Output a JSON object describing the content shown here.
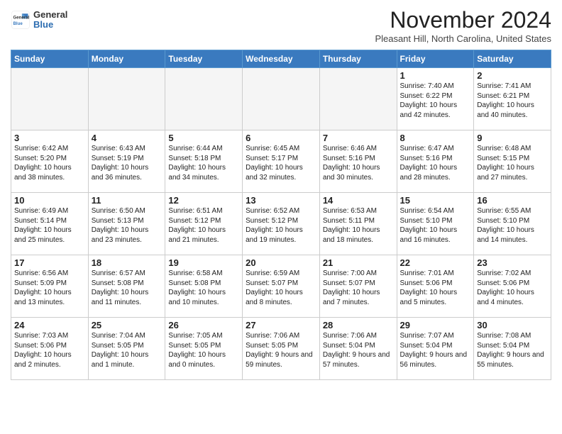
{
  "header": {
    "logo_line1": "General",
    "logo_line2": "Blue",
    "month_title": "November 2024",
    "location": "Pleasant Hill, North Carolina, United States"
  },
  "weekdays": [
    "Sunday",
    "Monday",
    "Tuesday",
    "Wednesday",
    "Thursday",
    "Friday",
    "Saturday"
  ],
  "weeks": [
    [
      {
        "day": "",
        "empty": true
      },
      {
        "day": "",
        "empty": true
      },
      {
        "day": "",
        "empty": true
      },
      {
        "day": "",
        "empty": true
      },
      {
        "day": "",
        "empty": true
      },
      {
        "day": "1",
        "sunrise": "7:40 AM",
        "sunset": "6:22 PM",
        "daylight": "10 hours and 42 minutes."
      },
      {
        "day": "2",
        "sunrise": "7:41 AM",
        "sunset": "6:21 PM",
        "daylight": "10 hours and 40 minutes."
      }
    ],
    [
      {
        "day": "3",
        "sunrise": "6:42 AM",
        "sunset": "5:20 PM",
        "daylight": "10 hours and 38 minutes."
      },
      {
        "day": "4",
        "sunrise": "6:43 AM",
        "sunset": "5:19 PM",
        "daylight": "10 hours and 36 minutes."
      },
      {
        "day": "5",
        "sunrise": "6:44 AM",
        "sunset": "5:18 PM",
        "daylight": "10 hours and 34 minutes."
      },
      {
        "day": "6",
        "sunrise": "6:45 AM",
        "sunset": "5:17 PM",
        "daylight": "10 hours and 32 minutes."
      },
      {
        "day": "7",
        "sunrise": "6:46 AM",
        "sunset": "5:16 PM",
        "daylight": "10 hours and 30 minutes."
      },
      {
        "day": "8",
        "sunrise": "6:47 AM",
        "sunset": "5:16 PM",
        "daylight": "10 hours and 28 minutes."
      },
      {
        "day": "9",
        "sunrise": "6:48 AM",
        "sunset": "5:15 PM",
        "daylight": "10 hours and 27 minutes."
      }
    ],
    [
      {
        "day": "10",
        "sunrise": "6:49 AM",
        "sunset": "5:14 PM",
        "daylight": "10 hours and 25 minutes."
      },
      {
        "day": "11",
        "sunrise": "6:50 AM",
        "sunset": "5:13 PM",
        "daylight": "10 hours and 23 minutes."
      },
      {
        "day": "12",
        "sunrise": "6:51 AM",
        "sunset": "5:12 PM",
        "daylight": "10 hours and 21 minutes."
      },
      {
        "day": "13",
        "sunrise": "6:52 AM",
        "sunset": "5:12 PM",
        "daylight": "10 hours and 19 minutes."
      },
      {
        "day": "14",
        "sunrise": "6:53 AM",
        "sunset": "5:11 PM",
        "daylight": "10 hours and 18 minutes."
      },
      {
        "day": "15",
        "sunrise": "6:54 AM",
        "sunset": "5:10 PM",
        "daylight": "10 hours and 16 minutes."
      },
      {
        "day": "16",
        "sunrise": "6:55 AM",
        "sunset": "5:10 PM",
        "daylight": "10 hours and 14 minutes."
      }
    ],
    [
      {
        "day": "17",
        "sunrise": "6:56 AM",
        "sunset": "5:09 PM",
        "daylight": "10 hours and 13 minutes."
      },
      {
        "day": "18",
        "sunrise": "6:57 AM",
        "sunset": "5:08 PM",
        "daylight": "10 hours and 11 minutes."
      },
      {
        "day": "19",
        "sunrise": "6:58 AM",
        "sunset": "5:08 PM",
        "daylight": "10 hours and 10 minutes."
      },
      {
        "day": "20",
        "sunrise": "6:59 AM",
        "sunset": "5:07 PM",
        "daylight": "10 hours and 8 minutes."
      },
      {
        "day": "21",
        "sunrise": "7:00 AM",
        "sunset": "5:07 PM",
        "daylight": "10 hours and 7 minutes."
      },
      {
        "day": "22",
        "sunrise": "7:01 AM",
        "sunset": "5:06 PM",
        "daylight": "10 hours and 5 minutes."
      },
      {
        "day": "23",
        "sunrise": "7:02 AM",
        "sunset": "5:06 PM",
        "daylight": "10 hours and 4 minutes."
      }
    ],
    [
      {
        "day": "24",
        "sunrise": "7:03 AM",
        "sunset": "5:06 PM",
        "daylight": "10 hours and 2 minutes."
      },
      {
        "day": "25",
        "sunrise": "7:04 AM",
        "sunset": "5:05 PM",
        "daylight": "10 hours and 1 minute."
      },
      {
        "day": "26",
        "sunrise": "7:05 AM",
        "sunset": "5:05 PM",
        "daylight": "10 hours and 0 minutes."
      },
      {
        "day": "27",
        "sunrise": "7:06 AM",
        "sunset": "5:05 PM",
        "daylight": "9 hours and 59 minutes."
      },
      {
        "day": "28",
        "sunrise": "7:06 AM",
        "sunset": "5:04 PM",
        "daylight": "9 hours and 57 minutes."
      },
      {
        "day": "29",
        "sunrise": "7:07 AM",
        "sunset": "5:04 PM",
        "daylight": "9 hours and 56 minutes."
      },
      {
        "day": "30",
        "sunrise": "7:08 AM",
        "sunset": "5:04 PM",
        "daylight": "9 hours and 55 minutes."
      }
    ]
  ]
}
